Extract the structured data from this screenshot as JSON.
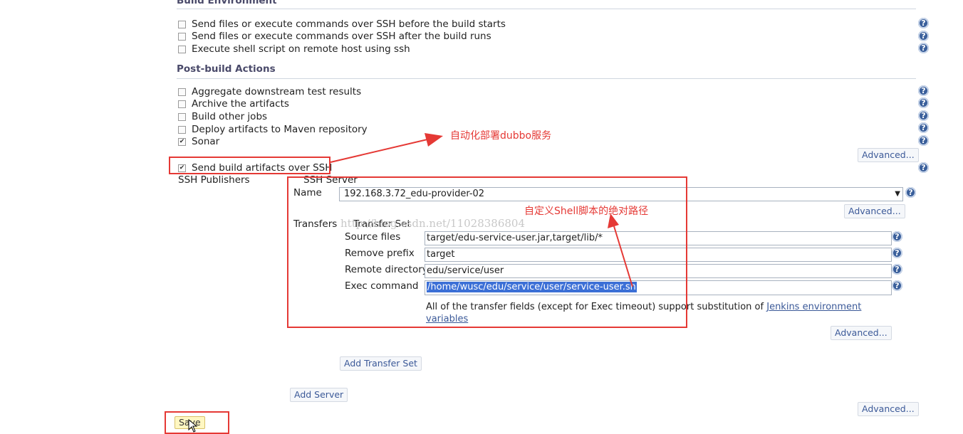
{
  "build_environment": {
    "title": "Build Environment",
    "items": [
      {
        "label": "Send files or execute commands over SSH before the build starts",
        "checked": false
      },
      {
        "label": "Send files or execute commands over SSH after the build runs",
        "checked": false
      },
      {
        "label": "Execute shell script on remote host using ssh",
        "checked": false
      }
    ]
  },
  "post_build": {
    "title": "Post-build Actions",
    "items": [
      {
        "label": "Aggregate downstream test results",
        "checked": false
      },
      {
        "label": "Archive the artifacts",
        "checked": false
      },
      {
        "label": "Build other jobs",
        "checked": false
      },
      {
        "label": "Deploy artifacts to Maven repository",
        "checked": false
      },
      {
        "label": "Sonar",
        "checked": true
      }
    ],
    "advanced_label": "Advanced...",
    "send_artifacts_label": "Send build artifacts over SSH",
    "check_mark": "✔"
  },
  "ssh": {
    "publishers_label": "SSH Publishers",
    "server_label": "SSH Server",
    "name_label": "Name",
    "name_value": "192.168.3.72_edu-provider-02",
    "advanced_label": "Advanced...",
    "transfers_label": "Transfers",
    "transfer_set_label": "Transfer Set",
    "source_files_label": "Source files",
    "source_files_value": "target/edu-service-user.jar,target/lib/*",
    "remove_prefix_label": "Remove prefix",
    "remove_prefix_value": "target",
    "remote_directory_label": "Remote directory",
    "remote_directory_value": "edu/service/user",
    "exec_command_label": "Exec command",
    "exec_command_value": "/home/wusc/edu/service/user/service-user.sh",
    "info_text": "All of the transfer fields (except for Exec timeout) support substitution of",
    "info_link_1": "Jenkins environment",
    "info_link_2": "variables",
    "transfer_advanced_label": "Advanced...",
    "add_transfer_set_label": "Add Transfer Set",
    "add_server_label": "Add Server",
    "bottom_advanced_label": "Advanced..."
  },
  "save_label": "Save",
  "annotations": {
    "deploy_note": "自动化部署dubbo服务",
    "shell_note": "自定义Shell脚本的绝对路径"
  },
  "watermark": "http://blog.csdn.net/11028386804",
  "help_glyph": "?",
  "select_arrow": "▼"
}
